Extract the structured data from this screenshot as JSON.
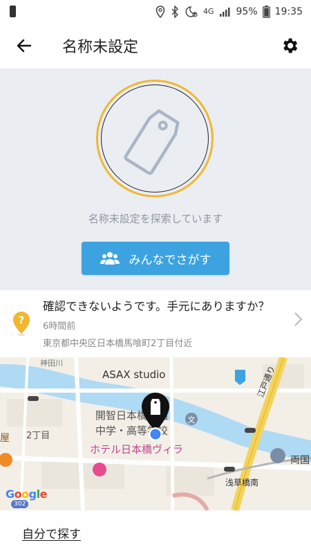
{
  "status_bar": {
    "battery_percent": "95%",
    "time": "19:35",
    "network": "4G",
    "icons": [
      "battery-small-icon",
      "location-icon",
      "bluetooth-icon",
      "do-not-disturb-alarm-icon",
      "signal-icon"
    ]
  },
  "app_bar": {
    "title": "名称未設定",
    "back_icon": "arrow-left-icon",
    "settings_icon": "gear-icon"
  },
  "search": {
    "status_text": "名称未設定を探索しています",
    "everyone_button_label": "みんなでさがす",
    "ring_color": "#f0b730",
    "button_color": "#3da3e0"
  },
  "notice": {
    "title": "確認できないようです。手元にありますか？",
    "time": "6時間前",
    "address": "東京都中央区日本橋馬喰町2丁目付近",
    "icon_color": "#f0b730"
  },
  "map": {
    "labels": {
      "top_left": "神田川",
      "asax": "ASAX studio",
      "school_line1": "開智日本橋学園",
      "school_line2": "中学・高等学校",
      "hotel": "ホテル日本橋ヴィラ",
      "nichome": "2丁目",
      "left_ya": "屋",
      "asakusabashi": "浅草橋南",
      "ryogoku": "両国",
      "edo_dori": "江戸通り"
    },
    "google_logo": "Google",
    "route_badge": "302"
  },
  "bottom": {
    "self_search_link": "自分で探す"
  }
}
